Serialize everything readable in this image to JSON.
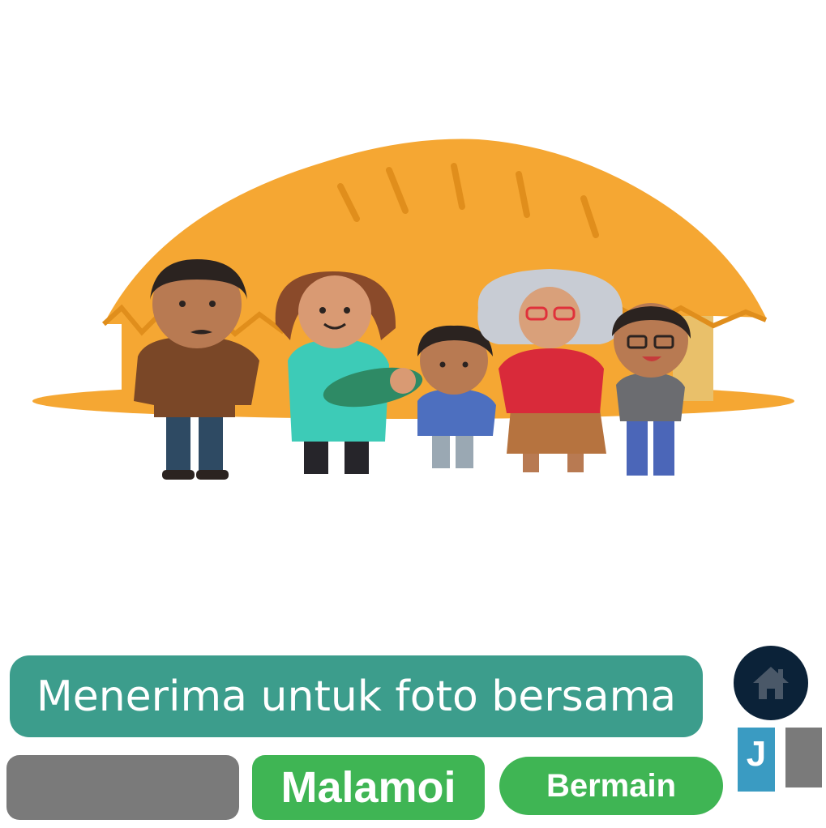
{
  "scene": {
    "illustration": "family-in-front-of-thatched-hut",
    "colors": {
      "thatch": "#f5a733",
      "thatch_dark": "#e08e1c",
      "skin": "#b87a52",
      "hair": "#2b2320"
    }
  },
  "prompt": {
    "text": "Menerima untuk foto bersama",
    "color": "#3c9d8c"
  },
  "answers": [
    {
      "label": "",
      "color": "#7a7a7a"
    },
    {
      "label": "Malamoi",
      "color": "#3fb554"
    }
  ],
  "play_button": {
    "label": "Bermain",
    "color": "#3fb554"
  },
  "home_button": {
    "icon": "home-icon",
    "color": "#0b2238"
  },
  "letter_tile": {
    "label": "J",
    "color": "#3a9bc2"
  },
  "blank_tile": {
    "color": "#7a7a7a"
  }
}
